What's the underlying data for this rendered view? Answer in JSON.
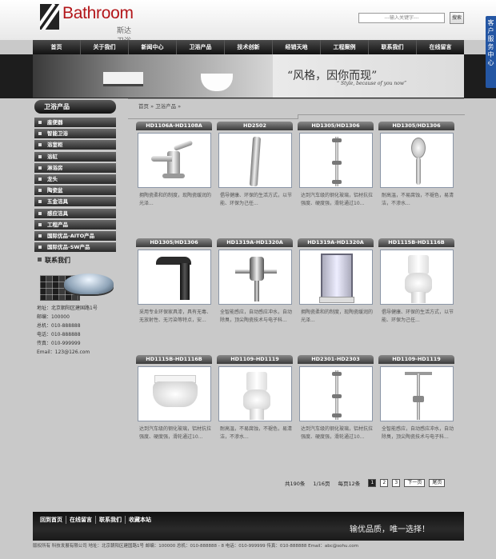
{
  "header": {
    "logo_text": "Bathroom",
    "logo_sub": "斯达卫浴",
    "search_placeholder": "---输入关键字---",
    "search_button": "搜索",
    "side_tab": "客户服务中心"
  },
  "nav": [
    "首页",
    "关于我们",
    "新闻中心",
    "卫浴产品",
    "技术创新",
    "经销天地",
    "工程案例",
    "联系我们",
    "在线留言"
  ],
  "banner": {
    "slogan": "“风格，因你而现”",
    "sub": "“ Style, because of you now”"
  },
  "sidebar": {
    "title": "卫浴产品",
    "items": [
      "座便器",
      "智能卫浴",
      "浴室柜",
      "浴缸",
      "淋浴房",
      "龙头",
      "陶瓷盆",
      "五金洁具",
      "感应洁具",
      "工程产品",
      "国际优品-AITO产品",
      "国际优品-SW产品"
    ],
    "contact_title": "联系我们",
    "contact_lines": [
      "地址：北京朝阳区建国路1号",
      "邮编：100000",
      "总机：010-888888",
      "电话：010-888888",
      "传真：010-999999",
      "Email：123@126.com"
    ]
  },
  "breadcrumb": "首页 » 卫浴产品 »",
  "products": [
    {
      "title": "HD1106A-HD1108A",
      "desc": "拥陶瓷柔和的制度，现陶瓷缓润的光泽...",
      "icon": "faucet"
    },
    {
      "title": "HD2502",
      "desc": "倡导健康、环保的生活方式，以节能、环保为己任...",
      "icon": "shower-panel"
    },
    {
      "title": "HD1305/HD1306",
      "desc": "达到汽车级的钢化玻璃，铝材抗拉强度、硬度强，滑轮通过10...",
      "icon": "slide-bar"
    },
    {
      "title": "HD1305/HD1306",
      "desc": "耐高温，不易腐蚀，不褪色，易清洁，不渗水...",
      "icon": "hand-shower"
    },
    {
      "title": "HD1305/HD1306",
      "desc": "采用专业环保家具漆，具有无毒、无放射性、无污染等特点，安...",
      "icon": "sensor-faucet"
    },
    {
      "title": "HD1319A-HD1320A",
      "desc": "全智能感应，自动感应冲水，自动除臭，顶尖陶瓷技术与电子科...",
      "icon": "urinal-valve"
    },
    {
      "title": "HD1319A-HD1320A",
      "desc": "拥陶瓷柔和的制度，现陶瓷缓润的光泽...",
      "icon": "shower-cabin"
    },
    {
      "title": "HD1115B-HD1116B",
      "desc": "倡导健康、环保的生活方式，以节能、环保为己任...",
      "icon": "toilet"
    },
    {
      "title": "HD1115B-HD1116B",
      "desc": "达到汽车级的钢化玻璃，铝材抗拉强度、硬度强，滑轮通过10...",
      "icon": "wall-toilet"
    },
    {
      "title": "HD1109-HD1119",
      "desc": "耐高温，不易腐蚀，不褪色，易清洁，不渗水...",
      "icon": "toilet"
    },
    {
      "title": "HD2301-HD2303",
      "desc": "达到汽车级的钢化玻璃，铝材抗拉强度、硬度强，滑轮通过10...",
      "icon": "slide-bar"
    },
    {
      "title": "HD1109-HD1119",
      "desc": "全智能感应，自动感应冲水，自动除臭，顶尖陶瓷技术与电子科...",
      "icon": "rain-shower"
    }
  ],
  "pager": {
    "total": "共190条",
    "page": "1/16页",
    "per_page": "每页12条",
    "pages": [
      "1",
      "2",
      "3"
    ],
    "next": "下一页",
    "last": "尾页"
  },
  "footer": {
    "links": [
      "回到首页",
      "在线留言",
      "联系我们",
      "收藏本站"
    ],
    "slogan": "输优品质，唯一选择！",
    "copyright": "版权所有  科技发展有限公司 地址：北京朝阳区建国路1号 邮编：100000   总机：010-888888 - 8 电话：010-999999 传真：010-888888 Email：abc@sohu.com"
  }
}
